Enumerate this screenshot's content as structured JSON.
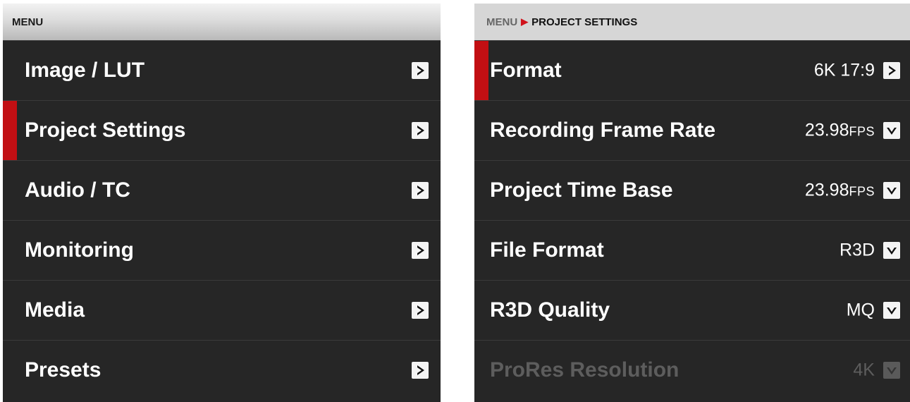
{
  "menu": {
    "header": "MENU",
    "items": [
      {
        "label": "Image / LUT"
      },
      {
        "label": "Project Settings"
      },
      {
        "label": "Audio / TC"
      },
      {
        "label": "Monitoring"
      },
      {
        "label": "Media"
      },
      {
        "label": "Presets"
      }
    ]
  },
  "project_settings": {
    "breadcrumb_root": "MENU",
    "breadcrumb_separator": ">",
    "breadcrumb_current": "PROJECT SETTINGS",
    "items": [
      {
        "label": "Format",
        "value": "6K 17:9",
        "unit": ""
      },
      {
        "label": "Recording Frame Rate",
        "value": "23.98",
        "unit": "FPS"
      },
      {
        "label": "Project Time Base",
        "value": "23.98",
        "unit": "FPS"
      },
      {
        "label": "File Format",
        "value": "R3D",
        "unit": ""
      },
      {
        "label": "R3D Quality",
        "value": "MQ",
        "unit": ""
      },
      {
        "label": "ProRes Resolution",
        "value": "4K",
        "unit": ""
      }
    ]
  },
  "colors": {
    "accent": "#c20f13",
    "panel_background": "#262626",
    "disabled_text": "#5d5d5d"
  },
  "icons": {
    "submenu": "chevron-right-icon",
    "dropdown": "chevron-down-icon"
  }
}
